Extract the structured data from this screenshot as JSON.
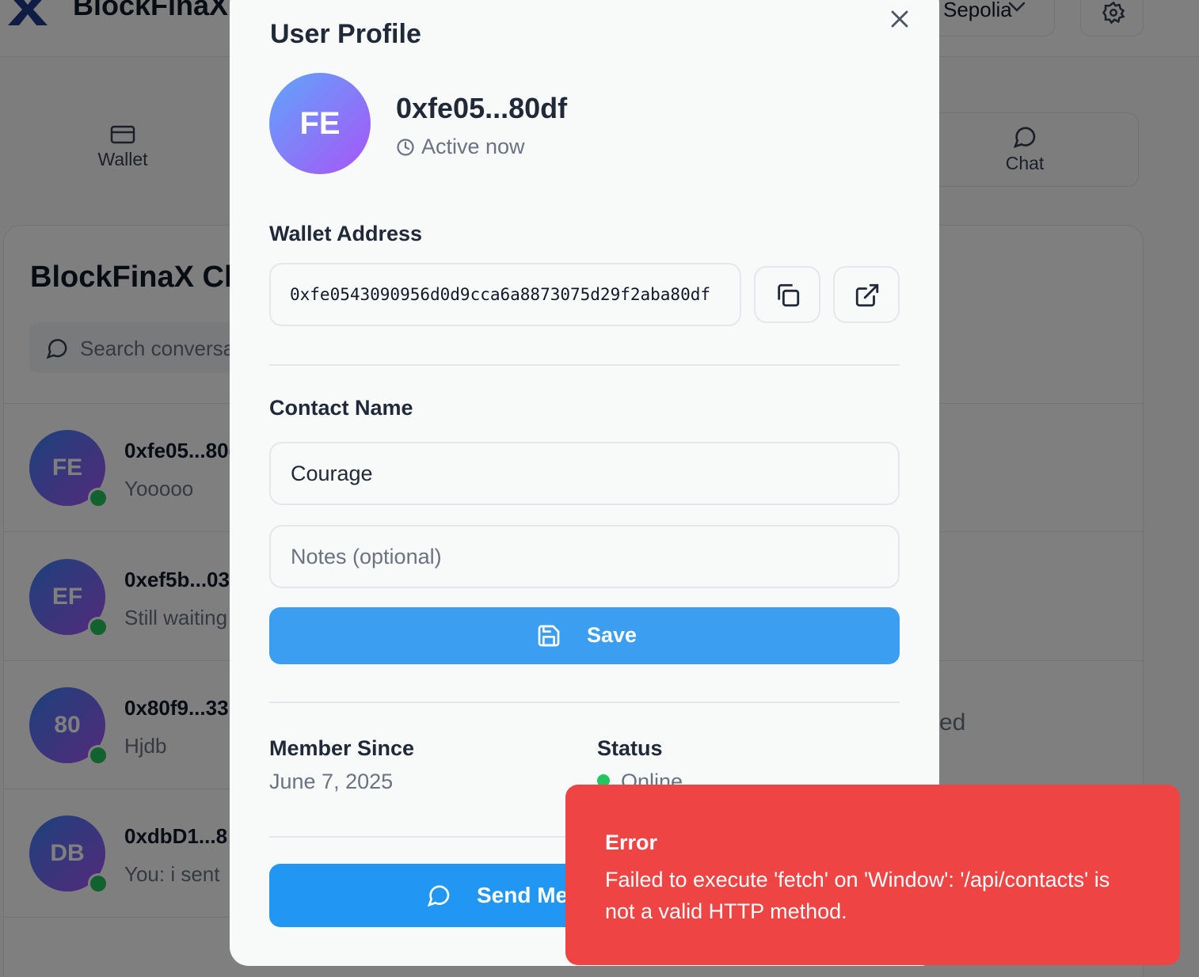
{
  "app": {
    "brand": "BlockFinaX",
    "network_label": "Sepolia",
    "nav_tabs": [
      {
        "label": "Wallet"
      },
      {
        "label": "Chat"
      }
    ]
  },
  "chat_panel": {
    "title": "BlockFinaX Chat",
    "search_placeholder": "Search conversations",
    "conversations": [
      {
        "initials": "FE",
        "name": "0xfe05...80df",
        "last_message": "Yooooo",
        "online": true
      },
      {
        "initials": "EF",
        "name": "0xef5b...03",
        "last_message": "Still waiting",
        "online": true
      },
      {
        "initials": "80",
        "name": "0x80f9...33",
        "last_message": "Hjdb",
        "online": true
      },
      {
        "initials": "DB",
        "name": "0xdbD1...8",
        "last_message": "You: i sent",
        "online": true
      }
    ],
    "partial_text": "ed"
  },
  "modal": {
    "title": "User Profile",
    "avatar_initials": "FE",
    "display_name": "0xfe05...80df",
    "active_status": "Active now",
    "wallet_address_label": "Wallet Address",
    "wallet_address": "0xfe0543090956d0d9cca6a8873075d29f2aba80df",
    "contact_name_label": "Contact Name",
    "contact_name_value": "Courage",
    "notes_placeholder": "Notes (optional)",
    "save_label": "Save",
    "member_since_label": "Member Since",
    "member_since_value": "June 7, 2025",
    "status_label": "Status",
    "status_value": "Online",
    "send_message_label": "Send Message"
  },
  "toast": {
    "title": "Error",
    "message": "Failed to execute 'fetch' on 'Window': '/api/contacts' is not a valid HTTP method."
  },
  "colors": {
    "primary_blue": "#3b9ef0",
    "send_blue": "#2196f3",
    "error_red": "#ef4444",
    "online_green": "#22c55e",
    "avatar_gradient": [
      "#60a5fa",
      "#a855f7"
    ]
  },
  "icons": {
    "close": "close-icon",
    "clock": "clock-icon",
    "copy": "copy-icon",
    "external_link": "external-link-icon",
    "save": "save-icon",
    "chat_bubble": "message-circle-icon",
    "wallet": "wallet-icon",
    "settings": "gear-icon",
    "search": "search-icon",
    "chevron": "chevron-down-icon"
  }
}
